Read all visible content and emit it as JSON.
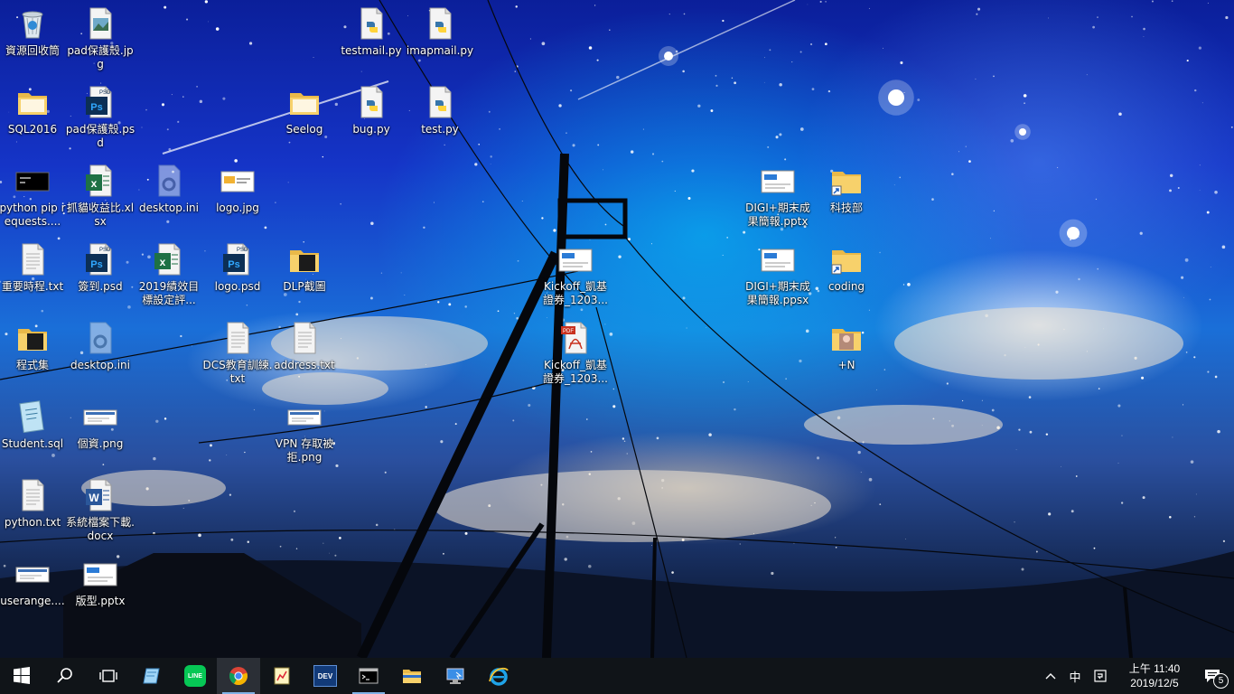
{
  "desktop": {
    "icons": [
      {
        "label": "資源回收筒",
        "type": "recycle-bin",
        "col": 0,
        "row": 0
      },
      {
        "label": "pad保護殼.jpg",
        "type": "image-file",
        "col": 1,
        "row": 0
      },
      {
        "label": "testmail.py",
        "type": "python-file",
        "col": 5,
        "row": 0
      },
      {
        "label": "imapmail.py",
        "type": "python-file",
        "col": 6,
        "row": 0
      },
      {
        "label": "SQL2016",
        "type": "folder",
        "col": 0,
        "row": 1
      },
      {
        "label": "pad保護殼.psd",
        "type": "psd-file",
        "col": 1,
        "row": 1
      },
      {
        "label": "Seelog",
        "type": "folder",
        "col": 4,
        "row": 1
      },
      {
        "label": "bug.py",
        "type": "python-file",
        "col": 5,
        "row": 1
      },
      {
        "label": "test.py",
        "type": "python-file",
        "col": 6,
        "row": 1
      },
      {
        "label": "python pip requests....",
        "type": "console-shortcut",
        "col": 0,
        "row": 2
      },
      {
        "label": "抓貓收益比.xlsx",
        "type": "excel-file",
        "col": 1,
        "row": 2
      },
      {
        "label": "desktop.ini",
        "type": "settings-file-faded",
        "col": 2,
        "row": 2
      },
      {
        "label": "logo.jpg",
        "type": "image-logo",
        "col": 3,
        "row": 2
      },
      {
        "label": "DIGI+期末成果簡報.pptx",
        "type": "pptx-slide",
        "col": 11,
        "row": 2
      },
      {
        "label": "科技部",
        "type": "folder-shortcut",
        "col": 12,
        "row": 2
      },
      {
        "label": "重要時程.txt",
        "type": "text-file",
        "col": 0,
        "row": 3
      },
      {
        "label": "簽到.psd",
        "type": "psd-file",
        "col": 1,
        "row": 3
      },
      {
        "label": "2019績效目標設定評...",
        "type": "excel-file",
        "col": 2,
        "row": 3
      },
      {
        "label": "logo.psd",
        "type": "psd-file",
        "col": 3,
        "row": 3
      },
      {
        "label": "DLP截圖",
        "type": "folder-dark",
        "col": 4,
        "row": 3
      },
      {
        "label": "Kickoff_凱基證券_1203...",
        "type": "pptx-slide",
        "col": 8,
        "row": 3
      },
      {
        "label": "DIGI+期末成果簡報.ppsx",
        "type": "pptx-slide",
        "col": 11,
        "row": 3
      },
      {
        "label": "coding",
        "type": "folder-shortcut",
        "col": 12,
        "row": 3
      },
      {
        "label": "程式集",
        "type": "folder-dark",
        "col": 0,
        "row": 4
      },
      {
        "label": "desktop.ini",
        "type": "settings-file-faded",
        "col": 1,
        "row": 4
      },
      {
        "label": "DCS教育訓練.txt",
        "type": "text-file",
        "col": 3,
        "row": 4
      },
      {
        "label": "address.txt",
        "type": "text-file",
        "col": 4,
        "row": 4
      },
      {
        "label": "Kickoff_凱基證券_1203...",
        "type": "pdf-file",
        "col": 8,
        "row": 4
      },
      {
        "label": "+N",
        "type": "folder-photo",
        "col": 12,
        "row": 4
      },
      {
        "label": "Student.sql",
        "type": "sql-file",
        "col": 0,
        "row": 5
      },
      {
        "label": "個資.png",
        "type": "png-screenshot",
        "col": 1,
        "row": 5
      },
      {
        "label": "VPN 存取被拒.png",
        "type": "png-screenshot",
        "col": 4,
        "row": 5
      },
      {
        "label": "python.txt",
        "type": "text-file",
        "col": 0,
        "row": 6
      },
      {
        "label": "系統檔案下載.docx",
        "type": "word-file",
        "col": 1,
        "row": 6
      },
      {
        "label": "userange....",
        "type": "png-screenshot",
        "col": 0,
        "row": 7
      },
      {
        "label": "版型.pptx",
        "type": "pptx-slide",
        "col": 1,
        "row": 7
      }
    ]
  },
  "taskbar": {
    "buttons": [
      {
        "name": "start-button",
        "icon": "windows-logo-icon",
        "running": false
      },
      {
        "name": "search-button",
        "icon": "search-icon",
        "running": false
      },
      {
        "name": "task-view-button",
        "icon": "task-view-icon",
        "running": false
      },
      {
        "name": "notepad-like-button",
        "icon": "blue-app-icon",
        "running": false
      },
      {
        "name": "line-app-button",
        "icon": "line-icon",
        "running": false
      },
      {
        "name": "chrome-button",
        "icon": "chrome-icon",
        "running": true,
        "active": true
      },
      {
        "name": "app-chart-button",
        "icon": "chart-editor-icon",
        "running": false
      },
      {
        "name": "devc-button",
        "icon": "dev-cpp-icon",
        "running": false
      },
      {
        "name": "cmd-button",
        "icon": "command-prompt-icon",
        "running": true
      },
      {
        "name": "file-explorer-button",
        "icon": "folder-icon",
        "running": false
      },
      {
        "name": "remote-desktop-button",
        "icon": "remote-desktop-icon",
        "running": false
      },
      {
        "name": "ie-button",
        "icon": "internet-explorer-icon",
        "running": false
      }
    ],
    "line_label": "LINE",
    "dev_label": "DEV",
    "tray": {
      "chevron": "^",
      "ime": "中",
      "clock_time": "上午 11:40",
      "clock_date": "2019/12/5",
      "notification_count": "5"
    },
    "colors": {
      "accent": "#7fb2e6",
      "background": "#101418"
    }
  }
}
